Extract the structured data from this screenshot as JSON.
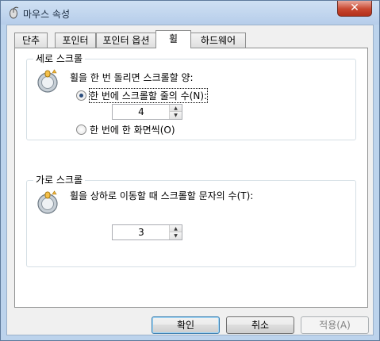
{
  "window": {
    "title": "마우스 속성",
    "close_label": "✕"
  },
  "tabs": [
    {
      "label": "단추"
    },
    {
      "label": "포인터"
    },
    {
      "label": "포인터 옵션"
    },
    {
      "label": "휠"
    },
    {
      "label": "하드웨어"
    }
  ],
  "vertical": {
    "group_label": "세로 스크롤",
    "prompt": "휠을 한 번 돌리면 스크롤할 양:",
    "option_lines": "한 번에 스크롤할 줄의 수(N):",
    "lines_value": "4",
    "option_screen": "한 번에 한 화면씩(O)"
  },
  "horizontal": {
    "group_label": "가로 스크롤",
    "prompt": "휠을 상하로 이동할 때 스크롤할 문자의 수(T):",
    "chars_value": "3"
  },
  "buttons": {
    "ok": "확인",
    "cancel": "취소",
    "apply": "적용(A)"
  },
  "icons": {
    "title": "mouse-icon",
    "wheel": "mouse-wheel-icon",
    "up": "▲",
    "down": "▼"
  }
}
